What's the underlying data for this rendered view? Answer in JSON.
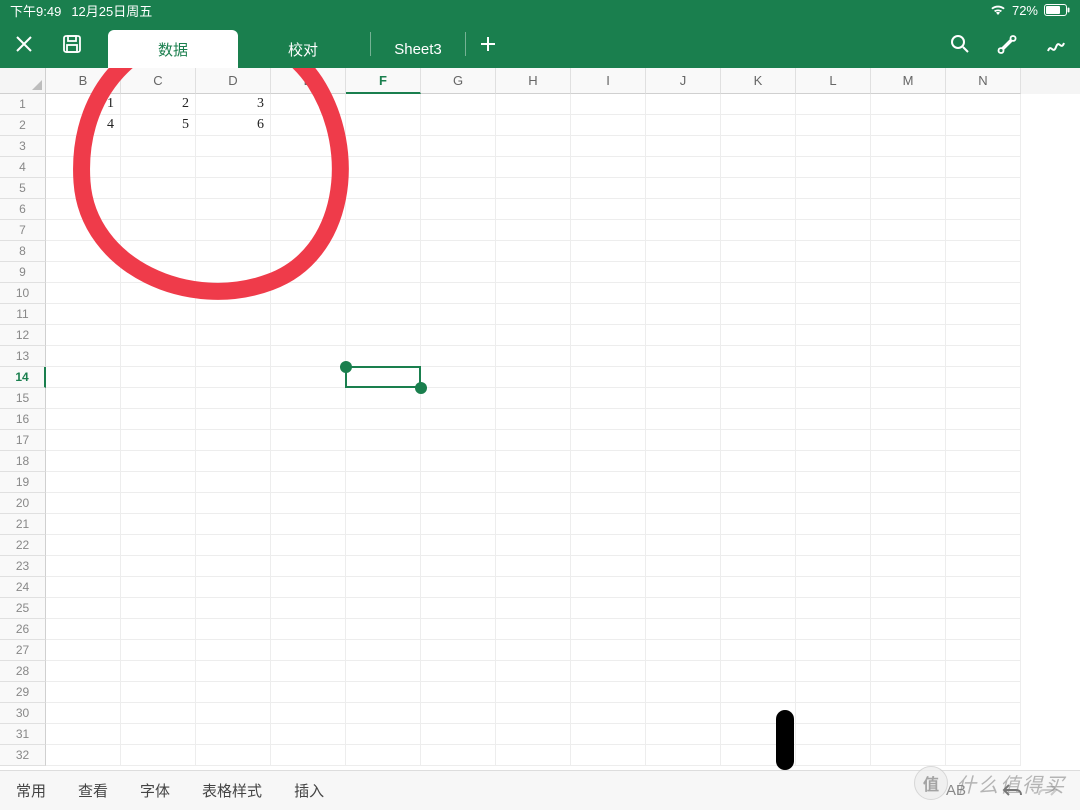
{
  "status": {
    "time": "下午9:49",
    "date": "12月25日周五",
    "battery": "72%"
  },
  "toolbar": {
    "tabs": [
      {
        "label": "数据",
        "active": true
      },
      {
        "label": "校对",
        "active": false
      },
      {
        "label": "Sheet3",
        "active": false
      }
    ]
  },
  "grid": {
    "columns": [
      "B",
      "C",
      "D",
      "E",
      "F",
      "G",
      "H",
      "I",
      "J",
      "K",
      "L",
      "M",
      "N"
    ],
    "selected_column": "F",
    "row_count": 32,
    "selected_row": 14,
    "data_rows": [
      {
        "row": 1,
        "cells": {
          "B": "1",
          "C": "2",
          "D": "3"
        }
      },
      {
        "row": 2,
        "cells": {
          "B": "4",
          "C": "5",
          "D": "6"
        }
      }
    ],
    "selection_cell": "F14"
  },
  "bottom": {
    "items": [
      "常用",
      "查看",
      "字体",
      "表格样式",
      "插入"
    ],
    "keyboard_hint": "AB"
  },
  "watermark": {
    "badge": "值",
    "text": "什么值得买"
  },
  "colors": {
    "brand": "#1a7f4e",
    "annotation": "#ef3b4a"
  }
}
